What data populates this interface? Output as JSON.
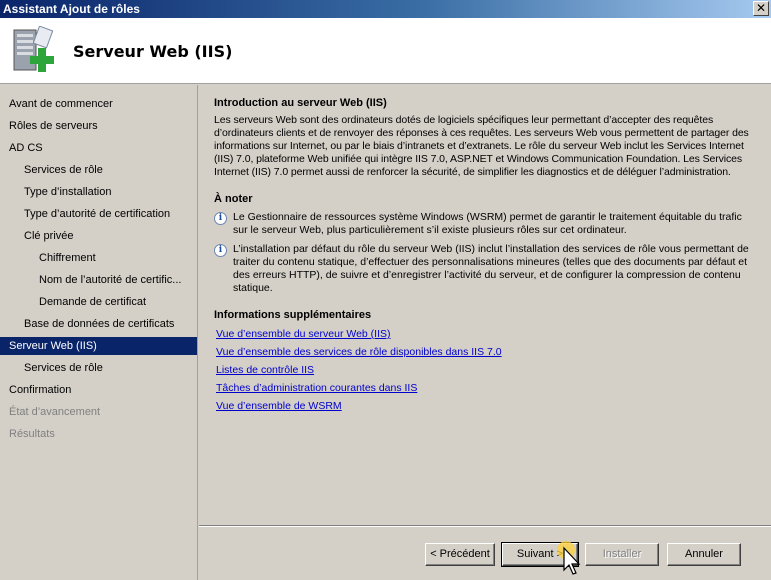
{
  "window": {
    "title": "Assistant Ajout de rôles",
    "close_glyph": "✕"
  },
  "header": {
    "title": "Serveur Web (IIS)",
    "icon": "server-add-icon"
  },
  "sidebar": {
    "items": [
      {
        "label": "Avant de commencer",
        "state": "normal"
      },
      {
        "label": "Rôles de serveurs",
        "state": "normal"
      },
      {
        "label": "AD CS",
        "state": "normal"
      },
      {
        "label": "Services de rôle",
        "state": "normal"
      },
      {
        "label": "Type d’installation",
        "state": "normal"
      },
      {
        "label": "Type d’autorité de certification",
        "state": "normal"
      },
      {
        "label": "Clé privée",
        "state": "normal"
      },
      {
        "label": "Chiffrement",
        "state": "normal"
      },
      {
        "label": "Nom de l’autorité de certific...",
        "state": "normal"
      },
      {
        "label": "Demande de certificat",
        "state": "normal"
      },
      {
        "label": "Base de données de certificats",
        "state": "normal"
      },
      {
        "label": "Serveur Web (IIS)",
        "state": "selected"
      },
      {
        "label": "Services de rôle",
        "state": "normal"
      },
      {
        "label": "Confirmation",
        "state": "normal"
      },
      {
        "label": "État d’avancement",
        "state": "disabled"
      },
      {
        "label": "Résultats",
        "state": "disabled"
      }
    ]
  },
  "main": {
    "intro_title": "Introduction au serveur Web (IIS)",
    "intro_text": "Les serveurs Web sont des ordinateurs dotés de logiciels spécifiques leur permettant d’accepter des requêtes d’ordinateurs clients et de renvoyer des réponses à ces requêtes. Les serveurs Web vous permettent de partager des informations sur Internet, ou par le biais d’intranets et d’extranets. Le rôle du serveur Web inclut les Services Internet (IIS) 7.0, plateforme Web unifiée qui intègre IIS 7.0, ASP.NET et Windows Communication Foundation. Les Services Internet (IIS) 7.0 permet aussi de renforcer la sécurité, de simplifier les diagnostics et de déléguer l’administration.",
    "notes_title": "À noter",
    "notes": [
      "Le Gestionnaire de ressources système Windows (WSRM) permet de garantir le traitement équitable du trafic sur le serveur Web, plus particulièrement s’il existe plusieurs rôles sur cet ordinateur.",
      "L’installation par défaut du rôle du serveur Web (IIS) inclut l’installation des services de rôle vous permettant de traiter du contenu statique, d’effectuer des personnalisations mineures (telles que des documents par défaut et des erreurs HTTP), de suivre et d’enregistrer l’activité du serveur, et de configurer la compression de contenu statique."
    ],
    "more_title": "Informations supplémentaires",
    "links": [
      "Vue d’ensemble du serveur Web (IIS)",
      "Vue d’ensemble des services de rôle disponibles dans IIS 7.0",
      "Listes de contrôle IIS",
      "Tâches d’administration courantes dans IIS",
      "Vue d’ensemble de WSRM"
    ]
  },
  "footer": {
    "prev_label": "< Précédent",
    "next_label": "Suivant >",
    "install_label": "Installer",
    "cancel_label": "Annuler"
  }
}
